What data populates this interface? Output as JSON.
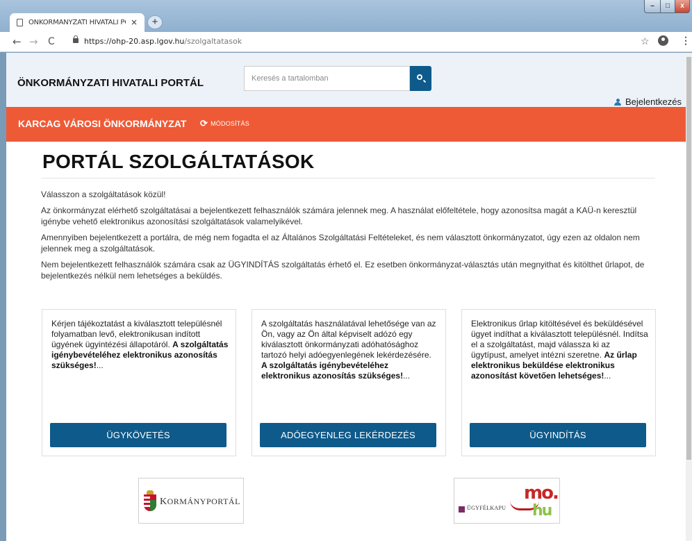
{
  "browser": {
    "tab_title": "ÖNKORMÁNYZATI HIVATALI PO",
    "tab_close": "×",
    "new_tab": "+",
    "url_host": "https://ohp-20.asp.lgov.hu",
    "url_path": "/szolgaltatasok",
    "nav_back": "←",
    "nav_forward": "→",
    "nav_reload": "C",
    "star": "☆",
    "menu": "⋮",
    "window_min": "–",
    "window_max": "□",
    "window_close": "x"
  },
  "header": {
    "portal_title": "ÖNKORMÁNYZATI HIVATALI PORTÁL",
    "search_placeholder": "Keresés a tartalomban",
    "login_label": "Bejelentkezés"
  },
  "org_bar": {
    "name": "KARCAG VÁROSI ÖNKORMÁNYZAT",
    "modify_label": "MÓDOSÍTÁS",
    "refresh_glyph": "⟳"
  },
  "main": {
    "heading": "PORTÁL SZOLGÁLTATÁSOK",
    "paragraphs": [
      "Válasszon a szolgáltatások közül!",
      "Az önkormányzat elérhető szolgáltatásai a bejelentkezett felhasználók számára jelennek meg. A használat előfeltétele, hogy azonosítsa magát a KAÜ-n keresztül igénybe vehető elektronikus azonosítási szolgáltatások valamelyikével.",
      "Amennyiben bejelentkezett a portálra, de még nem fogadta el az Általános Szolgáltatási Feltételeket, és nem választott önkormányzatot, úgy ezen az oldalon nem jelennek meg a szolgáltatások.",
      "Nem bejelentkezett felhasználók számára csak az ÜGYINDÍTÁS szolgáltatás érhető el. Ez esetben önkormányzat-választás után megnyithat és kitölthet űrlapot, de bejelentkezés nélkül nem lehetséges a beküldés."
    ]
  },
  "cards": [
    {
      "text": "Kérjen tájékoztatást a kiválasztott településnél folyamatban levő, elektronikusan indított ügyének ügyintézési állapotáról.",
      "bold": "A szolgáltatás igénybevételéhez elektronikus azonosítás szükséges!",
      "ellipsis": "...",
      "button": "ÜGYKÖVETÉS"
    },
    {
      "text": "A szolgáltatás használatával lehetősége van az Ön, vagy az Ön által képviselt adózó egy kiválasztott önkormányzati adóhatósághoz tartozó helyi adóegyenlegének lekérdezésére.",
      "bold": "A szolgáltatás igénybevételéhez elektronikus azonosítás szükséges!",
      "ellipsis": "...",
      "button": "ADÓEGYENLEG LEKÉRDEZÉS"
    },
    {
      "text": "Elektronikus űrlap kitöltésével és beküldésével ügyet indíthat a kiválasztott településnél. Indítsa el a szolgáltatást, majd válassza ki az ügytípust, amelyet intézni szeretne.",
      "bold": "Az űrlap elektronikus beküldése elektronikus azonosítást követően lehetséges!",
      "ellipsis": "...",
      "button": "ÜGYINDÍTÁS"
    }
  ],
  "logos": {
    "kormanyportal": {
      "first": "K",
      "rest": "ORMÁNYPORTÁL"
    },
    "ugyfelkapu": {
      "text": "ÜGYFÉLKAPU",
      "mo": "mo.",
      "hu": "hu"
    }
  },
  "colors": {
    "accent_blue": "#0e5a8a",
    "org_bar": "#ee5a36",
    "header_bg": "#edf2f8"
  }
}
